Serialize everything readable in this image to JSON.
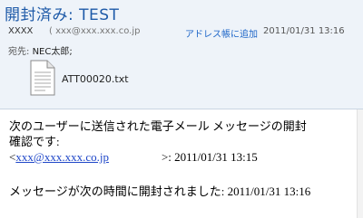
{
  "header": {
    "subject": "開封済み: TEST",
    "from_name": "XXXX",
    "from_email": "( xxx@xxx.xxx.co.jp",
    "add_to_contacts": "アドレス帳に追加",
    "date": "2011/01/31 13:16",
    "to_label": "宛先:",
    "to_value": "NEC太郎;"
  },
  "attachment": {
    "name": "ATT00020.txt",
    "icon": "text-file-icon"
  },
  "body": {
    "line1": "次のユーザーに送信された電子メール メッセージの開封",
    "line2": "確認です:",
    "line3_prefix": "<",
    "line3_link": "xxx@xxx.xxx.co.jp",
    "line3_suffix": ">: 2011/01/31 13:15",
    "line4": "メッセージが次の時間に開封されました: 2011/01/31 13:16"
  }
}
